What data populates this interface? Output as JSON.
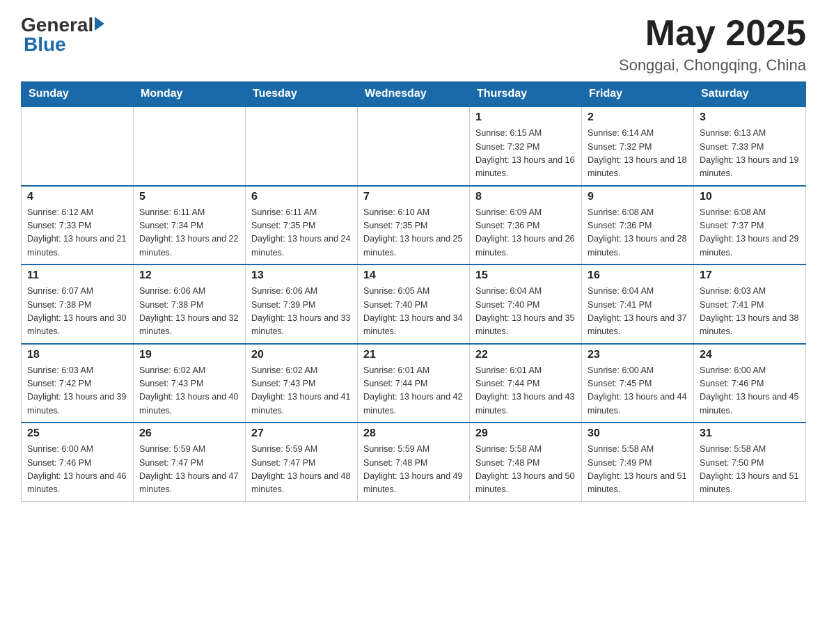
{
  "header": {
    "logo_general": "General",
    "logo_blue": "Blue",
    "month_year": "May 2025",
    "location": "Songgai, Chongqing, China"
  },
  "days_of_week": [
    "Sunday",
    "Monday",
    "Tuesday",
    "Wednesday",
    "Thursday",
    "Friday",
    "Saturday"
  ],
  "weeks": [
    [
      {
        "day": "",
        "info": ""
      },
      {
        "day": "",
        "info": ""
      },
      {
        "day": "",
        "info": ""
      },
      {
        "day": "",
        "info": ""
      },
      {
        "day": "1",
        "info": "Sunrise: 6:15 AM\nSunset: 7:32 PM\nDaylight: 13 hours and 16 minutes."
      },
      {
        "day": "2",
        "info": "Sunrise: 6:14 AM\nSunset: 7:32 PM\nDaylight: 13 hours and 18 minutes."
      },
      {
        "day": "3",
        "info": "Sunrise: 6:13 AM\nSunset: 7:33 PM\nDaylight: 13 hours and 19 minutes."
      }
    ],
    [
      {
        "day": "4",
        "info": "Sunrise: 6:12 AM\nSunset: 7:33 PM\nDaylight: 13 hours and 21 minutes."
      },
      {
        "day": "5",
        "info": "Sunrise: 6:11 AM\nSunset: 7:34 PM\nDaylight: 13 hours and 22 minutes."
      },
      {
        "day": "6",
        "info": "Sunrise: 6:11 AM\nSunset: 7:35 PM\nDaylight: 13 hours and 24 minutes."
      },
      {
        "day": "7",
        "info": "Sunrise: 6:10 AM\nSunset: 7:35 PM\nDaylight: 13 hours and 25 minutes."
      },
      {
        "day": "8",
        "info": "Sunrise: 6:09 AM\nSunset: 7:36 PM\nDaylight: 13 hours and 26 minutes."
      },
      {
        "day": "9",
        "info": "Sunrise: 6:08 AM\nSunset: 7:36 PM\nDaylight: 13 hours and 28 minutes."
      },
      {
        "day": "10",
        "info": "Sunrise: 6:08 AM\nSunset: 7:37 PM\nDaylight: 13 hours and 29 minutes."
      }
    ],
    [
      {
        "day": "11",
        "info": "Sunrise: 6:07 AM\nSunset: 7:38 PM\nDaylight: 13 hours and 30 minutes."
      },
      {
        "day": "12",
        "info": "Sunrise: 6:06 AM\nSunset: 7:38 PM\nDaylight: 13 hours and 32 minutes."
      },
      {
        "day": "13",
        "info": "Sunrise: 6:06 AM\nSunset: 7:39 PM\nDaylight: 13 hours and 33 minutes."
      },
      {
        "day": "14",
        "info": "Sunrise: 6:05 AM\nSunset: 7:40 PM\nDaylight: 13 hours and 34 minutes."
      },
      {
        "day": "15",
        "info": "Sunrise: 6:04 AM\nSunset: 7:40 PM\nDaylight: 13 hours and 35 minutes."
      },
      {
        "day": "16",
        "info": "Sunrise: 6:04 AM\nSunset: 7:41 PM\nDaylight: 13 hours and 37 minutes."
      },
      {
        "day": "17",
        "info": "Sunrise: 6:03 AM\nSunset: 7:41 PM\nDaylight: 13 hours and 38 minutes."
      }
    ],
    [
      {
        "day": "18",
        "info": "Sunrise: 6:03 AM\nSunset: 7:42 PM\nDaylight: 13 hours and 39 minutes."
      },
      {
        "day": "19",
        "info": "Sunrise: 6:02 AM\nSunset: 7:43 PM\nDaylight: 13 hours and 40 minutes."
      },
      {
        "day": "20",
        "info": "Sunrise: 6:02 AM\nSunset: 7:43 PM\nDaylight: 13 hours and 41 minutes."
      },
      {
        "day": "21",
        "info": "Sunrise: 6:01 AM\nSunset: 7:44 PM\nDaylight: 13 hours and 42 minutes."
      },
      {
        "day": "22",
        "info": "Sunrise: 6:01 AM\nSunset: 7:44 PM\nDaylight: 13 hours and 43 minutes."
      },
      {
        "day": "23",
        "info": "Sunrise: 6:00 AM\nSunset: 7:45 PM\nDaylight: 13 hours and 44 minutes."
      },
      {
        "day": "24",
        "info": "Sunrise: 6:00 AM\nSunset: 7:46 PM\nDaylight: 13 hours and 45 minutes."
      }
    ],
    [
      {
        "day": "25",
        "info": "Sunrise: 6:00 AM\nSunset: 7:46 PM\nDaylight: 13 hours and 46 minutes."
      },
      {
        "day": "26",
        "info": "Sunrise: 5:59 AM\nSunset: 7:47 PM\nDaylight: 13 hours and 47 minutes."
      },
      {
        "day": "27",
        "info": "Sunrise: 5:59 AM\nSunset: 7:47 PM\nDaylight: 13 hours and 48 minutes."
      },
      {
        "day": "28",
        "info": "Sunrise: 5:59 AM\nSunset: 7:48 PM\nDaylight: 13 hours and 49 minutes."
      },
      {
        "day": "29",
        "info": "Sunrise: 5:58 AM\nSunset: 7:48 PM\nDaylight: 13 hours and 50 minutes."
      },
      {
        "day": "30",
        "info": "Sunrise: 5:58 AM\nSunset: 7:49 PM\nDaylight: 13 hours and 51 minutes."
      },
      {
        "day": "31",
        "info": "Sunrise: 5:58 AM\nSunset: 7:50 PM\nDaylight: 13 hours and 51 minutes."
      }
    ]
  ]
}
